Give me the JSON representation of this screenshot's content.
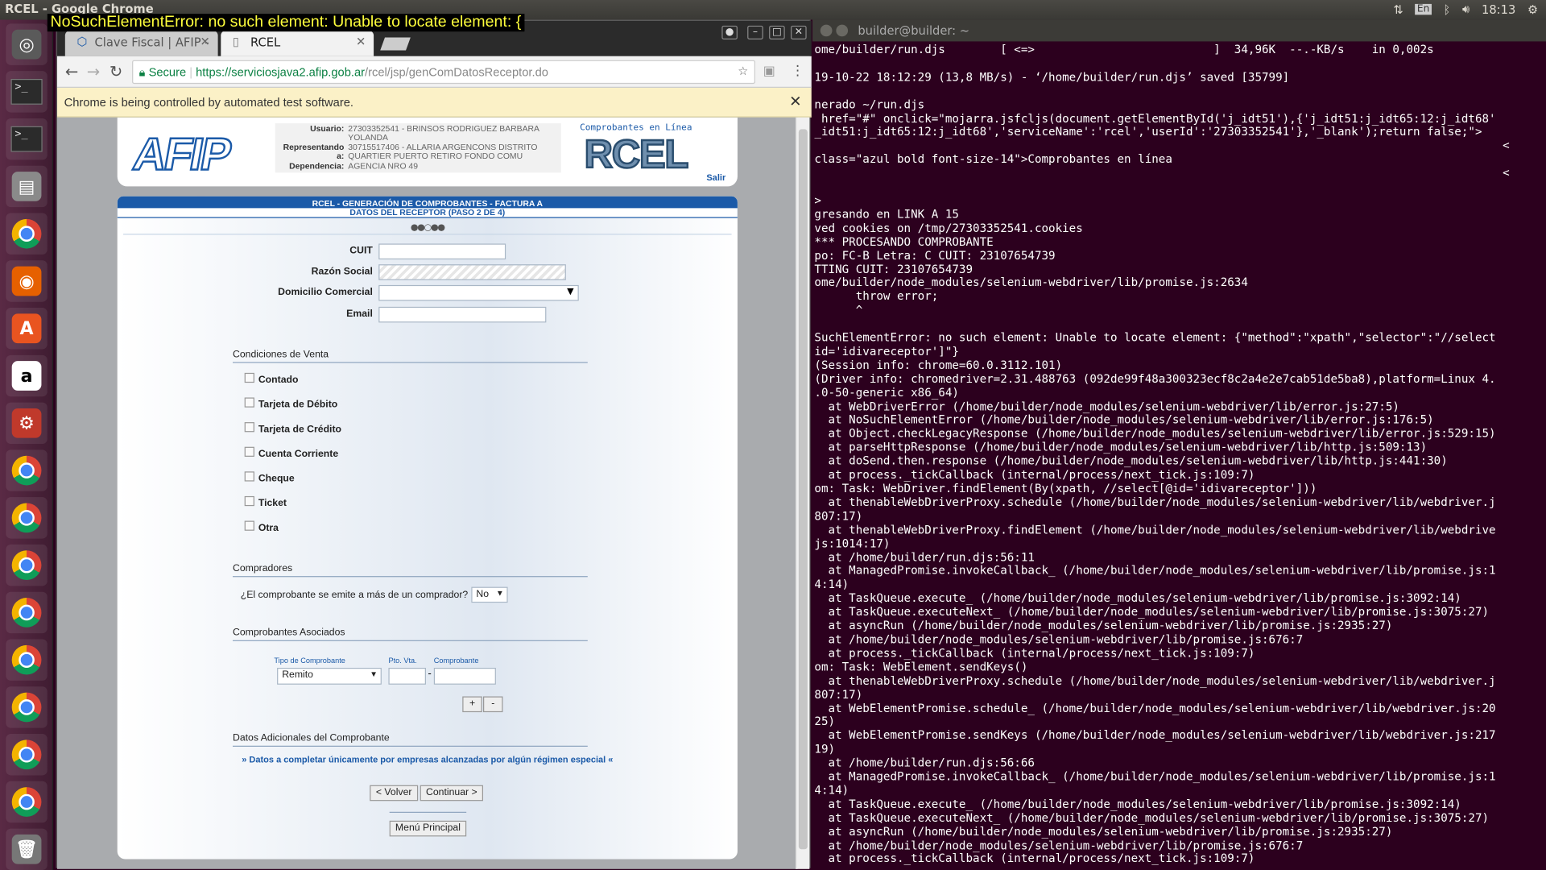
{
  "overlay_text": "NoSuchElementError: no such element: Unable to locate element: {",
  "topbar": {
    "title": "RCEL - Google Chrome",
    "keyboard": "En",
    "time": "18:13"
  },
  "launcher": {
    "icons": [
      "ubuntu-icon",
      "terminal-icon",
      "terminal-icon",
      "files-icon",
      "chrome-icon",
      "firefox-icon",
      "software-center-icon",
      "amazon-icon",
      "settings-icon",
      "chrome-icon",
      "chrome-icon",
      "chrome-icon",
      "chrome-icon",
      "chrome-icon",
      "chrome-icon",
      "chrome-icon",
      "chrome-icon",
      "trash-icon"
    ]
  },
  "browser": {
    "tabs": [
      {
        "label": "Clave Fiscal | AFIP -"
      },
      {
        "label": "RCEL"
      }
    ],
    "url_secure": "Secure",
    "url_scheme_host": "https://serviciosjava2.afip.gob.ar",
    "url_path": "/rcel/jsp/genComDatosReceptor.do",
    "infobar": "Chrome is being controlled by automated test software."
  },
  "page": {
    "logo": "AFIP",
    "user": {
      "usuario_label": "Usuario:",
      "usuario_value": "27303352541 - BRINSOS RODRIGUEZ BARBARA YOLANDA",
      "representando_label": "Representando a:",
      "representando_value": "30715517406 - ALLARIA ARGENCONS DISTRITO QUARTIER PUERTO RETIRO FONDO COMU",
      "dependencia_label": "Dependencia:",
      "dependencia_value": "AGENCIA NRO 49"
    },
    "rcel_sub": "Comprobantes en Línea",
    "rcel_big": "RCEL",
    "salir": "Salir",
    "heading_line1": "RCEL - GENERACIÓN DE COMPROBANTES - FACTURA A",
    "heading_line2": "DATOS DEL RECEPTOR (PASO 2 DE 4)",
    "steps": "●●○●●",
    "fields": {
      "cuit_label": "CUIT",
      "razon_label": "Razón Social",
      "domicilio_label": "Domicilio Comercial",
      "email_label": "Email"
    },
    "condiciones_title": "Condiciones de Venta",
    "condiciones": [
      "Contado",
      "Tarjeta de Débito",
      "Tarjeta de Crédito",
      "Cuenta Corriente",
      "Cheque",
      "Ticket",
      "Otra"
    ],
    "compradores_title": "Compradores",
    "compradores_question": "¿El comprobante se emite a más de un comprador?",
    "compradores_value": "No",
    "asociados_title": "Comprobantes Asociados",
    "asociados_cols": [
      "Tipo de Comprobante",
      "Pto. Vta.",
      "Comprobante"
    ],
    "asociados_tipo": "Remito",
    "asociados_sep": "-",
    "add_btn": "+",
    "remove_btn": "-",
    "adicionales_title": "Datos Adicionales del Comprobante",
    "adicionales_link": "» Datos a completar únicamente por empresas alcanzadas por algún régimen especial «",
    "volver": "< Volver",
    "continuar": "Continuar >",
    "menu": "Menú Principal"
  },
  "terminal": {
    "title": "builder@builder: ~",
    "lines": [
      "ome/builder/run.djs        [ <=>                          ]  34,96K  --.-KB/s    in 0,002s",
      "",
      "19-10-22 18:12:29 (13,8 MB/s) - ‘/home/builder/run.djs’ saved [35799]",
      "",
      "nerado ~/run.djs",
      " href=\"#\" onclick=\"mojarra.jsfcljs(document.getElementById('j_idt51'),{'j_idt51:j_idt65:12:j_idt68'",
      "_idt51:j_idt65:12:j_idt68','serviceName':'rcel','userId':'27303352541'},'_blank');return false;\">",
      "                                                                                                    <",
      "class=\"azul bold font-size-14\">Comprobantes en línea",
      "                                                                                                    <",
      "",
      ">",
      "gresando en LINK A 15",
      "ved cookies on /tmp/27303352541.cookies",
      "*** PROCESANDO COMPROBANTE",
      "po: FC-B Letra: C CUIT: 23107654739",
      "TTING CUIT: 23107654739",
      "ome/builder/node_modules/selenium-webdriver/lib/promise.js:2634",
      "      throw error;",
      "      ^",
      "",
      "SuchElementError: no such element: Unable to locate element: {\"method\":\"xpath\",\"selector\":\"//select",
      "id='idivareceptor']\"}",
      "(Session info: chrome=60.0.3112.101)",
      "(Driver info: chromedriver=2.31.488763 (092de99f48a300323ecf8c2a4e2e7cab51de5ba8),platform=Linux 4.",
      ".0-50-generic x86_64)",
      "  at WebDriverError (/home/builder/node_modules/selenium-webdriver/lib/error.js:27:5)",
      "  at NoSuchElementError (/home/builder/node_modules/selenium-webdriver/lib/error.js:176:5)",
      "  at Object.checkLegacyResponse (/home/builder/node_modules/selenium-webdriver/lib/error.js:529:15)",
      "  at parseHttpResponse (/home/builder/node_modules/selenium-webdriver/lib/http.js:509:13)",
      "  at doSend.then.response (/home/builder/node_modules/selenium-webdriver/lib/http.js:441:30)",
      "  at process._tickCallback (internal/process/next_tick.js:109:7)",
      "om: Task: WebDriver.findElement(By(xpath, //select[@id='idivareceptor']))",
      "  at thenableWebDriverProxy.schedule (/home/builder/node_modules/selenium-webdriver/lib/webdriver.j",
      "807:17)",
      "  at thenableWebDriverProxy.findElement (/home/builder/node_modules/selenium-webdriver/lib/webdrive",
      "js:1014:17)",
      "  at /home/builder/run.djs:56:11",
      "  at ManagedPromise.invokeCallback_ (/home/builder/node_modules/selenium-webdriver/lib/promise.js:1",
      "4:14)",
      "  at TaskQueue.execute_ (/home/builder/node_modules/selenium-webdriver/lib/promise.js:3092:14)",
      "  at TaskQueue.executeNext_ (/home/builder/node_modules/selenium-webdriver/lib/promise.js:3075:27)",
      "  at asyncRun (/home/builder/node_modules/selenium-webdriver/lib/promise.js:2935:27)",
      "  at /home/builder/node_modules/selenium-webdriver/lib/promise.js:676:7",
      "  at process._tickCallback (internal/process/next_tick.js:109:7)",
      "om: Task: WebElement.sendKeys()",
      "  at thenableWebDriverProxy.schedule (/home/builder/node_modules/selenium-webdriver/lib/webdriver.j",
      "807:17)",
      "  at WebElementPromise.schedule_ (/home/builder/node_modules/selenium-webdriver/lib/webdriver.js:20",
      "25)",
      "  at WebElementPromise.sendKeys (/home/builder/node_modules/selenium-webdriver/lib/webdriver.js:217",
      "19)",
      "  at /home/builder/run.djs:56:66",
      "  at ManagedPromise.invokeCallback_ (/home/builder/node_modules/selenium-webdriver/lib/promise.js:1",
      "4:14)",
      "  at TaskQueue.execute_ (/home/builder/node_modules/selenium-webdriver/lib/promise.js:3092:14)",
      "  at TaskQueue.executeNext_ (/home/builder/node_modules/selenium-webdriver/lib/promise.js:3075:27)",
      "  at asyncRun (/home/builder/node_modules/selenium-webdriver/lib/promise.js:2935:27)",
      "  at /home/builder/node_modules/selenium-webdriver/lib/promise.js:676:7",
      "  at process._tickCallback (internal/process/next_tick.js:109:7)"
    ]
  }
}
